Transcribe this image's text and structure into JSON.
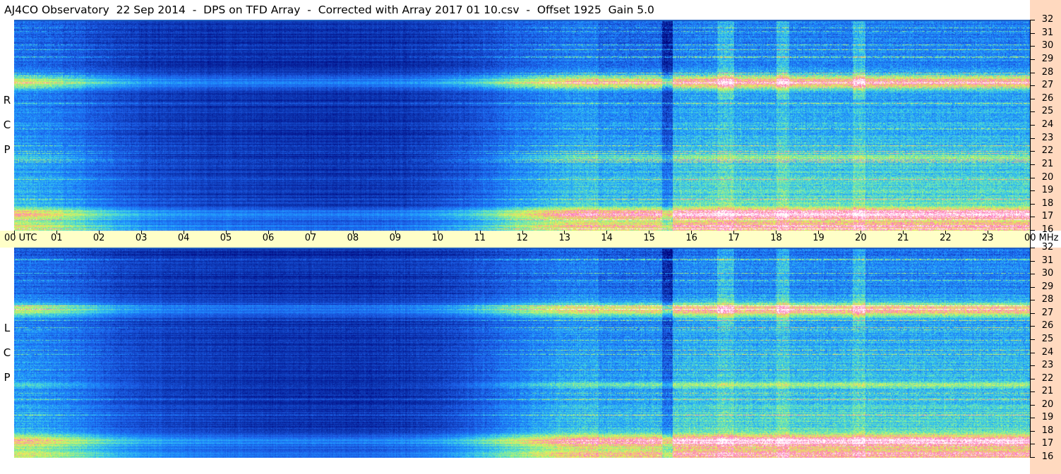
{
  "title": "AJ4CO Observatory  22 Sep 2014  -  DPS on TFD Array  -  Corrected with Array 2017 01 10.csv  -  Offset 1925  Gain 5.0",
  "chart_data": [
    {
      "type": "heatmap",
      "panel_label": [
        "R",
        "C",
        "P"
      ],
      "x_tick_labels": [
        "00 UTC",
        "01",
        "02",
        "03",
        "04",
        "05",
        "06",
        "07",
        "08",
        "09",
        "10",
        "11",
        "12",
        "13",
        "14",
        "15",
        "16",
        "17",
        "18",
        "19",
        "20",
        "21",
        "22",
        "23",
        "00 MHz"
      ],
      "x_range_hours": [
        0,
        24
      ],
      "y_tick_labels": [
        "32",
        "31",
        "30",
        "29",
        "28",
        "27",
        "26",
        "25",
        "24",
        "23",
        "22",
        "21",
        "20",
        "19",
        "18",
        "17",
        "16"
      ],
      "y_range_mhz": [
        16,
        32
      ],
      "colormap": [
        "#00007a",
        "#0a2fa8",
        "#1c5ce6",
        "#1e90ff",
        "#3cd0e6",
        "#8ef090",
        "#f0f050",
        "#ff70c0",
        "#ffffff"
      ],
      "features": [
        {
          "name": "broadcast band",
          "freq_mhz": 27.3,
          "hours": [
            0,
            24
          ]
        },
        {
          "name": "interference band",
          "freq_mhz": 17.2,
          "hours": [
            0,
            24
          ]
        }
      ]
    },
    {
      "type": "heatmap",
      "panel_label": [
        "L",
        "C",
        "P"
      ],
      "x_range_hours": [
        0,
        24
      ],
      "y_tick_labels": [
        "32",
        "31",
        "30",
        "29",
        "28",
        "27",
        "26",
        "25",
        "24",
        "23",
        "22",
        "21",
        "20",
        "19",
        "18",
        "17",
        "16"
      ],
      "y_range_mhz": [
        16,
        32
      ]
    }
  ],
  "panels": {
    "top": {
      "label": [
        "R",
        "C",
        "P"
      ]
    },
    "bottom": {
      "label": [
        "L",
        "C",
        "P"
      ]
    }
  },
  "xaxis": {
    "labels": [
      "00 UTC",
      "01",
      "02",
      "03",
      "04",
      "05",
      "06",
      "07",
      "08",
      "09",
      "10",
      "11",
      "12",
      "13",
      "14",
      "15",
      "16",
      "17",
      "18",
      "19",
      "20",
      "21",
      "22",
      "23",
      "00 MHz"
    ]
  },
  "yaxis": {
    "labels": [
      "32",
      "31",
      "30",
      "29",
      "28",
      "27",
      "26",
      "25",
      "24",
      "23",
      "22",
      "21",
      "20",
      "19",
      "18",
      "17",
      "16"
    ]
  }
}
